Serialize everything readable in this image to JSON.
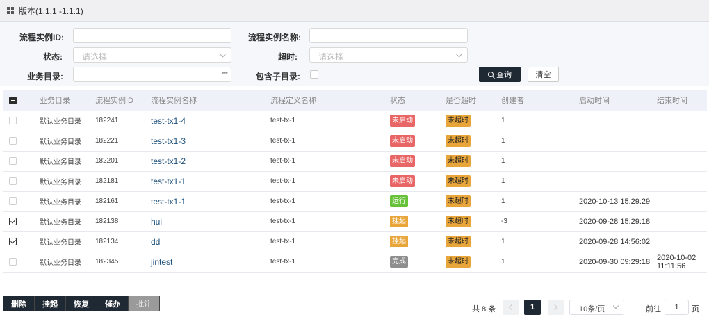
{
  "header": {
    "title": "版本(1.1.1 -1.1.1)"
  },
  "filters": {
    "instance_id_label": "流程实例ID:",
    "instance_name_label": "流程实例名称:",
    "status_label": "状态:",
    "status_placeholder": "请选择",
    "timeout_label": "超时:",
    "timeout_placeholder": "请选择",
    "catalog_label": "业务目录:",
    "catalog_more": "•••",
    "include_sub_label": "包含子目录:",
    "query_label": "查询",
    "clear_label": "清空"
  },
  "table": {
    "headers": [
      "业务目录",
      "流程实例ID",
      "流程实例名称",
      "流程定义名称",
      "状态",
      "是否超时",
      "创建者",
      "启动时间",
      "结束时间"
    ],
    "rows": [
      {
        "checked": false,
        "catalog": "默认业务目录",
        "id": "182241",
        "name": "test-tx1-4",
        "def": "test-tx-1",
        "status": "未启动",
        "status_color": "#e86666",
        "timeout": "未超时",
        "creator": "1",
        "start": "",
        "end": ""
      },
      {
        "checked": false,
        "catalog": "默认业务目录",
        "id": "182221",
        "name": "test-tx1-3",
        "def": "test-tx-1",
        "status": "未启动",
        "status_color": "#e86666",
        "timeout": "未超时",
        "creator": "1",
        "start": "",
        "end": ""
      },
      {
        "checked": false,
        "catalog": "默认业务目录",
        "id": "182201",
        "name": "test-tx1-2",
        "def": "test-tx-1",
        "status": "未启动",
        "status_color": "#e86666",
        "timeout": "未超时",
        "creator": "1",
        "start": "",
        "end": ""
      },
      {
        "checked": false,
        "catalog": "默认业务目录",
        "id": "182181",
        "name": "test-tx1-1",
        "def": "test-tx-1",
        "status": "未启动",
        "status_color": "#e86666",
        "timeout": "未超时",
        "creator": "1",
        "start": "",
        "end": ""
      },
      {
        "checked": false,
        "catalog": "默认业务目录",
        "id": "182161",
        "name": "test-tx1-1",
        "def": "test-tx-1",
        "status": "运行",
        "status_color": "#67c23a",
        "timeout": "未超时",
        "creator": "1",
        "start": "2020-10-13 15:29:29",
        "end": ""
      },
      {
        "checked": true,
        "catalog": "默认业务目录",
        "id": "182138",
        "name": "hui",
        "def": "test-tx-1",
        "status": "挂起",
        "status_color": "#e8a63a",
        "timeout": "未超时",
        "creator": "-3",
        "start": "2020-09-28 15:29:18",
        "end": ""
      },
      {
        "checked": true,
        "catalog": "默认业务目录",
        "id": "182134",
        "name": "dd",
        "def": "test-tx-1",
        "status": "挂起",
        "status_color": "#e8a63a",
        "timeout": "未超时",
        "creator": "1",
        "start": "2020-09-28 14:56:02",
        "end": ""
      },
      {
        "checked": false,
        "catalog": "默认业务目录",
        "id": "182345",
        "name": "jintest",
        "def": "test-tx-1",
        "status": "完成",
        "status_color": "#8e8e8e",
        "timeout": "未超时",
        "creator": "1",
        "start": "2020-09-30 09:29:18",
        "end": "2020-10-02 11:11:56"
      }
    ]
  },
  "actions": {
    "delete": "删除",
    "suspend": "挂起",
    "resume": "恢复",
    "urge": "催办",
    "annotate": "批注"
  },
  "pagination": {
    "total": "共 8 条",
    "current_page": "1",
    "page_size": "10条/页",
    "goto_prefix": "前往",
    "goto_value": "1",
    "goto_suffix": "页"
  },
  "colors": {
    "accent": "#1f2933",
    "timeout_tag": "#e8a63a"
  }
}
